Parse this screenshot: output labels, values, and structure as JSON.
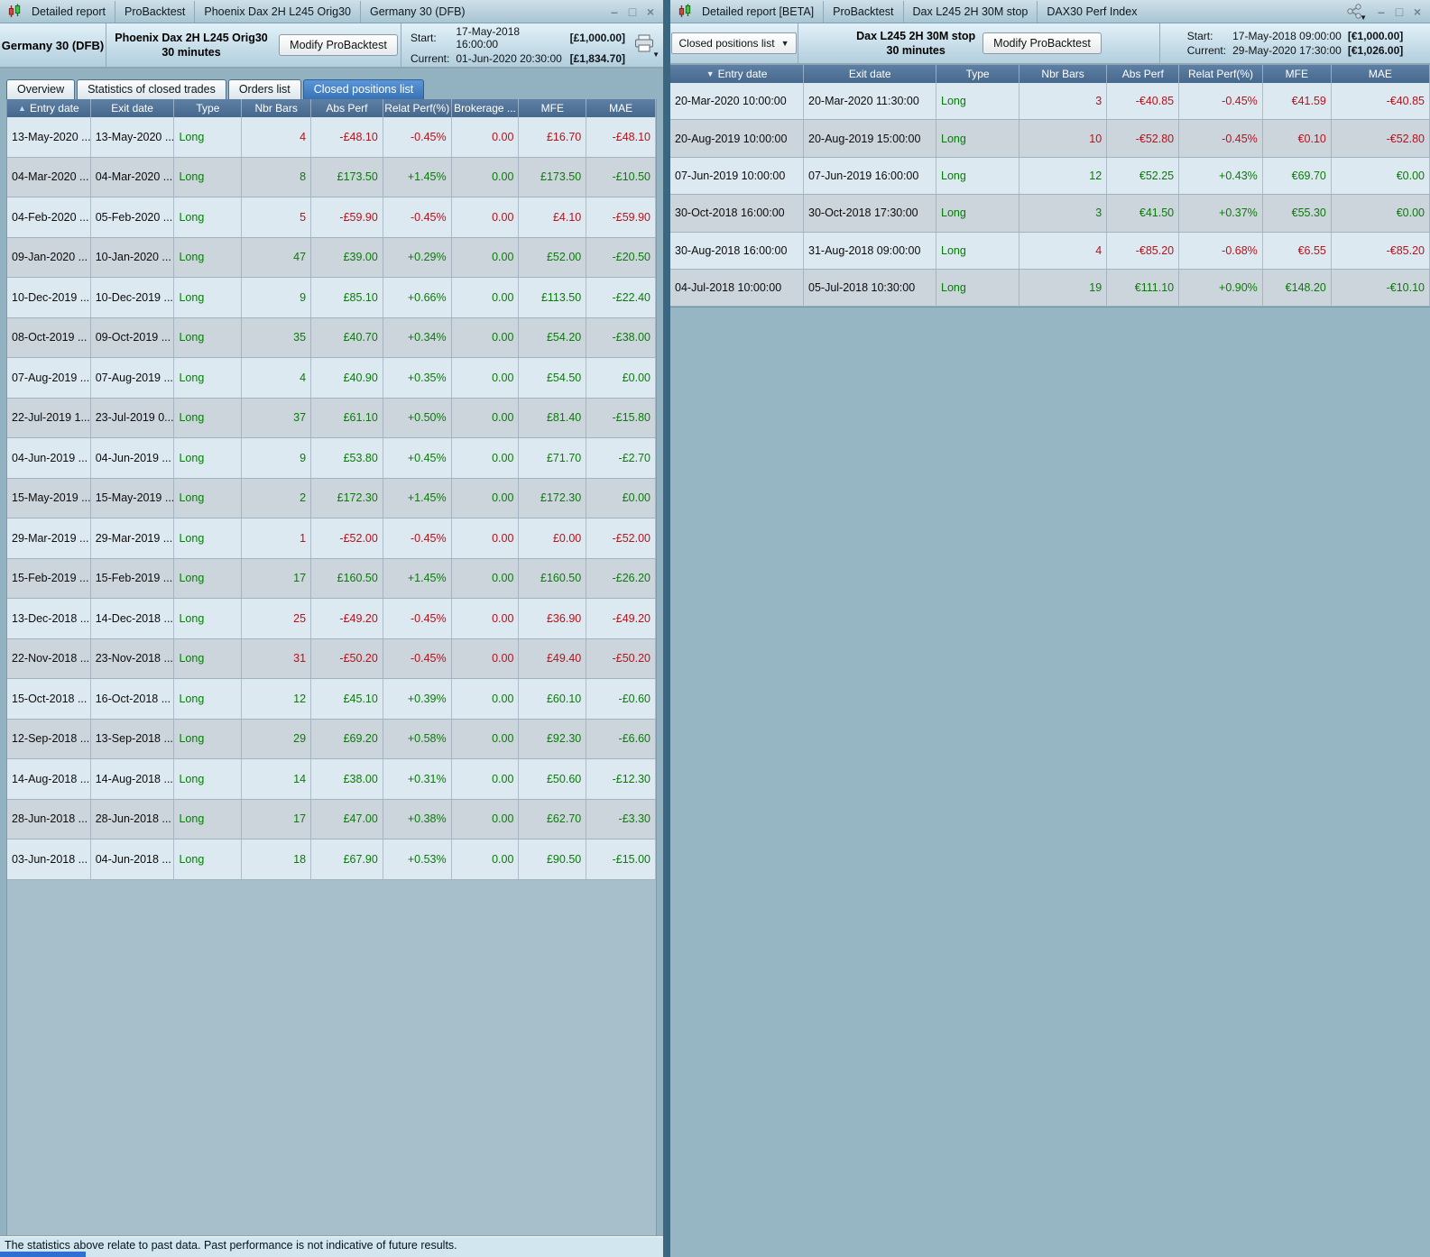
{
  "colors": {
    "profit": "#0b7a0b",
    "loss": "#b5121b",
    "type_green": "#008000",
    "table_header_bg": "#46688c",
    "active_tab": "#3672b4"
  },
  "left": {
    "titlebar": {
      "items": [
        "Detailed report",
        "ProBacktest",
        "Phoenix Dax 2H L245 Orig30",
        "Germany 30 (DFB)"
      ]
    },
    "header": {
      "instrument": "Germany 30 (DFB)",
      "strategy": "Phoenix Dax 2H L245 Orig30",
      "timeframe": "30 minutes",
      "modify_button": "Modify ProBacktest",
      "start_label": "Start:",
      "start_datetime": "17-May-2018 16:00:00",
      "start_amount": "[£1,000.00]",
      "current_label": "Current:",
      "current_datetime": "01-Jun-2020 20:30:00",
      "current_amount": "[£1,834.70]"
    },
    "tabs": [
      {
        "label": "Overview",
        "active": false
      },
      {
        "label": "Statistics of closed trades",
        "active": false
      },
      {
        "label": "Orders list",
        "active": false
      },
      {
        "label": "Closed positions list",
        "active": true
      }
    ],
    "table": {
      "sort": {
        "column": "Entry date",
        "direction": "ascending"
      },
      "columns": [
        "Entry date",
        "Exit date",
        "Type",
        "Nbr Bars",
        "Abs Perf",
        "Relat Perf(%)",
        "Brokerage ...",
        "MFE",
        "MAE"
      ],
      "rows": [
        {
          "entry": "13-May-2020 ...",
          "exit": "13-May-2020 ...",
          "type": "Long",
          "bars": "4",
          "abs": "-£48.10",
          "relat": "-0.45%",
          "brokerage": "0.00",
          "mfe": "£16.70",
          "mae": "-£48.10",
          "result": "loss"
        },
        {
          "entry": "04-Mar-2020 ...",
          "exit": "04-Mar-2020 ...",
          "type": "Long",
          "bars": "8",
          "abs": "£173.50",
          "relat": "+1.45%",
          "brokerage": "0.00",
          "mfe": "£173.50",
          "mae": "-£10.50",
          "result": "profit"
        },
        {
          "entry": "04-Feb-2020 ...",
          "exit": "05-Feb-2020 ...",
          "type": "Long",
          "bars": "5",
          "abs": "-£59.90",
          "relat": "-0.45%",
          "brokerage": "0.00",
          "mfe": "£4.10",
          "mae": "-£59.90",
          "result": "loss"
        },
        {
          "entry": "09-Jan-2020 ...",
          "exit": "10-Jan-2020 ...",
          "type": "Long",
          "bars": "47",
          "abs": "£39.00",
          "relat": "+0.29%",
          "brokerage": "0.00",
          "mfe": "£52.00",
          "mae": "-£20.50",
          "result": "profit"
        },
        {
          "entry": "10-Dec-2019 ...",
          "exit": "10-Dec-2019 ...",
          "type": "Long",
          "bars": "9",
          "abs": "£85.10",
          "relat": "+0.66%",
          "brokerage": "0.00",
          "mfe": "£113.50",
          "mae": "-£22.40",
          "result": "profit"
        },
        {
          "entry": "08-Oct-2019 ...",
          "exit": "09-Oct-2019 ...",
          "type": "Long",
          "bars": "35",
          "abs": "£40.70",
          "relat": "+0.34%",
          "brokerage": "0.00",
          "mfe": "£54.20",
          "mae": "-£38.00",
          "result": "profit"
        },
        {
          "entry": "07-Aug-2019 ...",
          "exit": "07-Aug-2019 ...",
          "type": "Long",
          "bars": "4",
          "abs": "£40.90",
          "relat": "+0.35%",
          "brokerage": "0.00",
          "mfe": "£54.50",
          "mae": "£0.00",
          "result": "profit"
        },
        {
          "entry": "22-Jul-2019 1...",
          "exit": "23-Jul-2019 0...",
          "type": "Long",
          "bars": "37",
          "abs": "£61.10",
          "relat": "+0.50%",
          "brokerage": "0.00",
          "mfe": "£81.40",
          "mae": "-£15.80",
          "result": "profit"
        },
        {
          "entry": "04-Jun-2019 ...",
          "exit": "04-Jun-2019 ...",
          "type": "Long",
          "bars": "9",
          "abs": "£53.80",
          "relat": "+0.45%",
          "brokerage": "0.00",
          "mfe": "£71.70",
          "mae": "-£2.70",
          "result": "profit"
        },
        {
          "entry": "15-May-2019 ...",
          "exit": "15-May-2019 ...",
          "type": "Long",
          "bars": "2",
          "abs": "£172.30",
          "relat": "+1.45%",
          "brokerage": "0.00",
          "mfe": "£172.30",
          "mae": "£0.00",
          "result": "profit"
        },
        {
          "entry": "29-Mar-2019 ...",
          "exit": "29-Mar-2019 ...",
          "type": "Long",
          "bars": "1",
          "abs": "-£52.00",
          "relat": "-0.45%",
          "brokerage": "0.00",
          "mfe": "£0.00",
          "mae": "-£52.00",
          "result": "loss"
        },
        {
          "entry": "15-Feb-2019 ...",
          "exit": "15-Feb-2019 ...",
          "type": "Long",
          "bars": "17",
          "abs": "£160.50",
          "relat": "+1.45%",
          "brokerage": "0.00",
          "mfe": "£160.50",
          "mae": "-£26.20",
          "result": "profit"
        },
        {
          "entry": "13-Dec-2018 ...",
          "exit": "14-Dec-2018 ...",
          "type": "Long",
          "bars": "25",
          "abs": "-£49.20",
          "relat": "-0.45%",
          "brokerage": "0.00",
          "mfe": "£36.90",
          "mae": "-£49.20",
          "result": "loss"
        },
        {
          "entry": "22-Nov-2018 ...",
          "exit": "23-Nov-2018 ...",
          "type": "Long",
          "bars": "31",
          "abs": "-£50.20",
          "relat": "-0.45%",
          "brokerage": "0.00",
          "mfe": "£49.40",
          "mae": "-£50.20",
          "result": "loss"
        },
        {
          "entry": "15-Oct-2018 ...",
          "exit": "16-Oct-2018 ...",
          "type": "Long",
          "bars": "12",
          "abs": "£45.10",
          "relat": "+0.39%",
          "brokerage": "0.00",
          "mfe": "£60.10",
          "mae": "-£0.60",
          "result": "profit"
        },
        {
          "entry": "12-Sep-2018 ...",
          "exit": "13-Sep-2018 ...",
          "type": "Long",
          "bars": "29",
          "abs": "£69.20",
          "relat": "+0.58%",
          "brokerage": "0.00",
          "mfe": "£92.30",
          "mae": "-£6.60",
          "result": "profit"
        },
        {
          "entry": "14-Aug-2018 ...",
          "exit": "14-Aug-2018 ...",
          "type": "Long",
          "bars": "14",
          "abs": "£38.00",
          "relat": "+0.31%",
          "brokerage": "0.00",
          "mfe": "£50.60",
          "mae": "-£12.30",
          "result": "profit"
        },
        {
          "entry": "28-Jun-2018 ...",
          "exit": "28-Jun-2018 ...",
          "type": "Long",
          "bars": "17",
          "abs": "£47.00",
          "relat": "+0.38%",
          "brokerage": "0.00",
          "mfe": "£62.70",
          "mae": "-£3.30",
          "result": "profit"
        },
        {
          "entry": "03-Jun-2018 ...",
          "exit": "04-Jun-2018 ...",
          "type": "Long",
          "bars": "18",
          "abs": "£67.90",
          "relat": "+0.53%",
          "brokerage": "0.00",
          "mfe": "£90.50",
          "mae": "-£15.00",
          "result": "profit"
        }
      ]
    },
    "footer": "The statistics above relate to past data. Past performance is not indicative of future results."
  },
  "right": {
    "titlebar": {
      "items": [
        "Detailed report [BETA]",
        "ProBacktest",
        "Dax L245 2H 30M stop",
        "DAX30 Perf Index"
      ]
    },
    "header": {
      "view_dropdown": "Closed positions list",
      "strategy": "Dax L245 2H 30M stop",
      "timeframe": "30 minutes",
      "modify_button": "Modify ProBacktest",
      "start_label": "Start:",
      "start_datetime": "17-May-2018 09:00:00",
      "start_amount": "[€1,000.00]",
      "current_label": "Current:",
      "current_datetime": "29-May-2020 17:30:00",
      "current_amount": "[€1,026.00]"
    },
    "table": {
      "sort": {
        "column": "Entry date",
        "direction": "descending"
      },
      "columns": [
        "Entry date",
        "Exit date",
        "Type",
        "Nbr Bars",
        "Abs Perf",
        "Relat Perf(%)",
        "MFE",
        "MAE"
      ],
      "rows": [
        {
          "entry": "20-Mar-2020 10:00:00",
          "exit": "20-Mar-2020 11:30:00",
          "type": "Long",
          "bars": "3",
          "abs": "-€40.85",
          "relat": "-0.45%",
          "mfe": "€41.59",
          "mae": "-€40.85",
          "result": "loss"
        },
        {
          "entry": "20-Aug-2019 10:00:00",
          "exit": "20-Aug-2019 15:00:00",
          "type": "Long",
          "bars": "10",
          "abs": "-€52.80",
          "relat": "-0.45%",
          "mfe": "€0.10",
          "mae": "-€52.80",
          "result": "loss"
        },
        {
          "entry": "07-Jun-2019 10:00:00",
          "exit": "07-Jun-2019 16:00:00",
          "type": "Long",
          "bars": "12",
          "abs": "€52.25",
          "relat": "+0.43%",
          "mfe": "€69.70",
          "mae": "€0.00",
          "result": "profit"
        },
        {
          "entry": "30-Oct-2018 16:00:00",
          "exit": "30-Oct-2018 17:30:00",
          "type": "Long",
          "bars": "3",
          "abs": "€41.50",
          "relat": "+0.37%",
          "mfe": "€55.30",
          "mae": "€0.00",
          "result": "profit"
        },
        {
          "entry": "30-Aug-2018 16:00:00",
          "exit": "31-Aug-2018 09:00:00",
          "type": "Long",
          "bars": "4",
          "abs": "-€85.20",
          "relat": "-0.68%",
          "mfe": "€6.55",
          "mae": "-€85.20",
          "result": "loss"
        },
        {
          "entry": "04-Jul-2018 10:00:00",
          "exit": "05-Jul-2018 10:30:00",
          "type": "Long",
          "bars": "19",
          "abs": "€111.10",
          "relat": "+0.90%",
          "mfe": "€148.20",
          "mae": "-€10.10",
          "result": "profit"
        }
      ]
    }
  },
  "icons": {
    "app": "candlestick-icon",
    "print": "printer-icon",
    "share": "share-icon",
    "window": [
      "minimize-icon",
      "maximize-icon",
      "close-icon"
    ],
    "sort": [
      "sort-asc-icon",
      "sort-desc-icon"
    ],
    "dropdown": "chevron-down-icon"
  }
}
